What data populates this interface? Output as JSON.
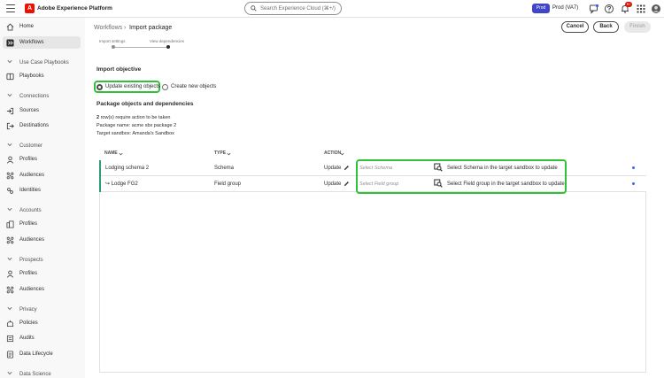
{
  "header": {
    "app_name": "Adobe Experience Platform",
    "search_placeholder": "Search Experience Cloud (⌘+/)",
    "env_badge": "Prod",
    "env_label": "Prod (VA7)",
    "notification_count": "9+",
    "colors": {
      "brand": "#eb1000",
      "env_badge": "#4046ca",
      "notif_badge": "#d31510"
    }
  },
  "sidebar": {
    "items": [
      {
        "label": "Home",
        "icon": "home-icon",
        "type": "item"
      },
      {
        "label": "Workflows",
        "icon": "workflows-icon",
        "type": "item",
        "active": true
      },
      {
        "label": "Use Case Playbooks",
        "type": "section"
      },
      {
        "label": "Playbooks",
        "icon": "playbooks-icon",
        "type": "item"
      },
      {
        "label": "Connections",
        "type": "section"
      },
      {
        "label": "Sources",
        "icon": "sources-icon",
        "type": "item"
      },
      {
        "label": "Destinations",
        "icon": "destinations-icon",
        "type": "item"
      },
      {
        "label": "Customer",
        "type": "section"
      },
      {
        "label": "Profiles",
        "icon": "profiles-icon",
        "type": "item"
      },
      {
        "label": "Audiences",
        "icon": "audiences-icon",
        "type": "item"
      },
      {
        "label": "Identities",
        "icon": "identities-icon",
        "type": "item"
      },
      {
        "label": "Accounts",
        "type": "section"
      },
      {
        "label": "Profiles",
        "icon": "account-profiles-icon",
        "type": "item"
      },
      {
        "label": "Audiences",
        "icon": "audiences-icon",
        "type": "item"
      },
      {
        "label": "Prospects",
        "type": "section"
      },
      {
        "label": "Profiles",
        "icon": "profiles-icon",
        "type": "item"
      },
      {
        "label": "Audiences",
        "icon": "audiences-icon",
        "type": "item"
      },
      {
        "label": "Privacy",
        "type": "section"
      },
      {
        "label": "Policies",
        "icon": "policies-icon",
        "type": "item"
      },
      {
        "label": "Audits",
        "icon": "audits-icon",
        "type": "item"
      },
      {
        "label": "Data Lifecycle",
        "icon": "data-lifecycle-icon",
        "type": "item"
      },
      {
        "label": "Data Science",
        "type": "section"
      }
    ]
  },
  "breadcrumb": {
    "parent": "Workflows",
    "separator": "›",
    "current": "Import package"
  },
  "steps": [
    {
      "label": "Import settings",
      "done": true
    },
    {
      "label": "View dependencies",
      "current": true
    }
  ],
  "actions": {
    "cancel": "Cancel",
    "back": "Back",
    "finish": "Finish"
  },
  "import_objective": {
    "title": "Import objective",
    "options": [
      {
        "label": "Update existing objects",
        "selected": true
      },
      {
        "label": "Create new objects",
        "selected": false
      }
    ]
  },
  "package": {
    "title": "Package objects and dependencies",
    "rows_count": "2",
    "rows_text": "row(s) require action to be taken",
    "name_line": "Package name: acme sbx package 2",
    "sandbox_line": "Target sandbox: Amanda's Sandbox"
  },
  "table": {
    "columns": [
      "NAME",
      "TYPE",
      "ACTION"
    ],
    "rows": [
      {
        "name": "Lodging schema 2",
        "type": "Schema",
        "action": "Update",
        "select_placeholder": "Select Schema",
        "hint": "Select Schema in the target sandbox to update"
      },
      {
        "name": "↪ Lodge FG2",
        "type": "Field group",
        "action": "Update",
        "select_placeholder": "Select Field group",
        "hint": "Select Field group in the target sandbox to update"
      }
    ]
  },
  "colors": {
    "highlight": "#2fc239",
    "row_accent": "#2d9d78",
    "dot": "#3b63fb"
  }
}
